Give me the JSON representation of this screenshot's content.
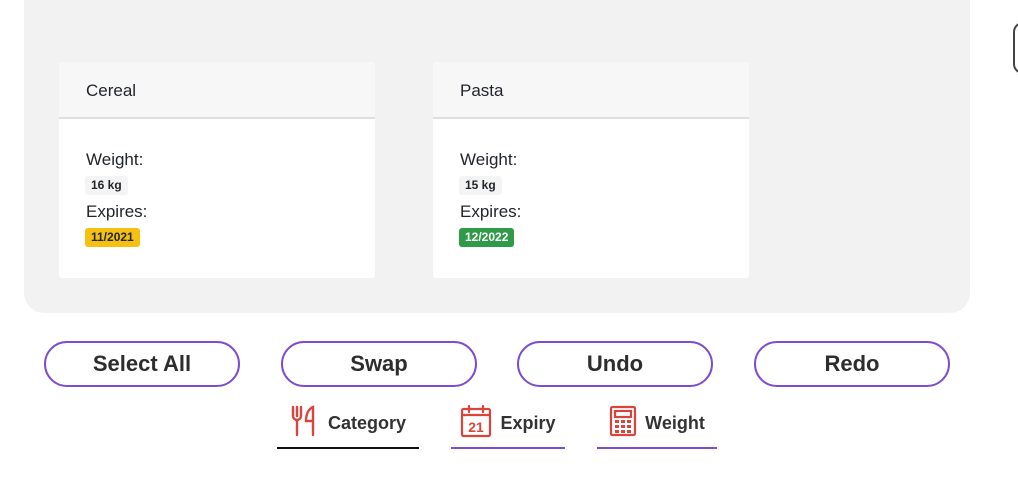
{
  "cards": [
    {
      "title": "Cereal",
      "weight_label": "Weight:",
      "weight": "16 kg",
      "expires_label": "Expires:",
      "expires": "11/2021",
      "expires_color": "#f5c011"
    },
    {
      "title": "Pasta",
      "weight_label": "Weight:",
      "weight": "15 kg",
      "expires_label": "Expires:",
      "expires": "12/2022",
      "expires_color": "#2f9a47"
    }
  ],
  "actions": {
    "select_all": "Select All",
    "swap": "Swap",
    "undo": "Undo",
    "redo": "Redo"
  },
  "tabs": [
    {
      "label": "Category",
      "icon": "fork-knife-icon",
      "active": true
    },
    {
      "label": "Expiry",
      "icon": "calendar-icon",
      "icon_text": "21",
      "active": false
    },
    {
      "label": "Weight",
      "icon": "calculator-icon",
      "active": false
    }
  ],
  "colors": {
    "accent": "#7c4dcf",
    "icon_red": "#d9453a",
    "active_underline": "#111111"
  }
}
